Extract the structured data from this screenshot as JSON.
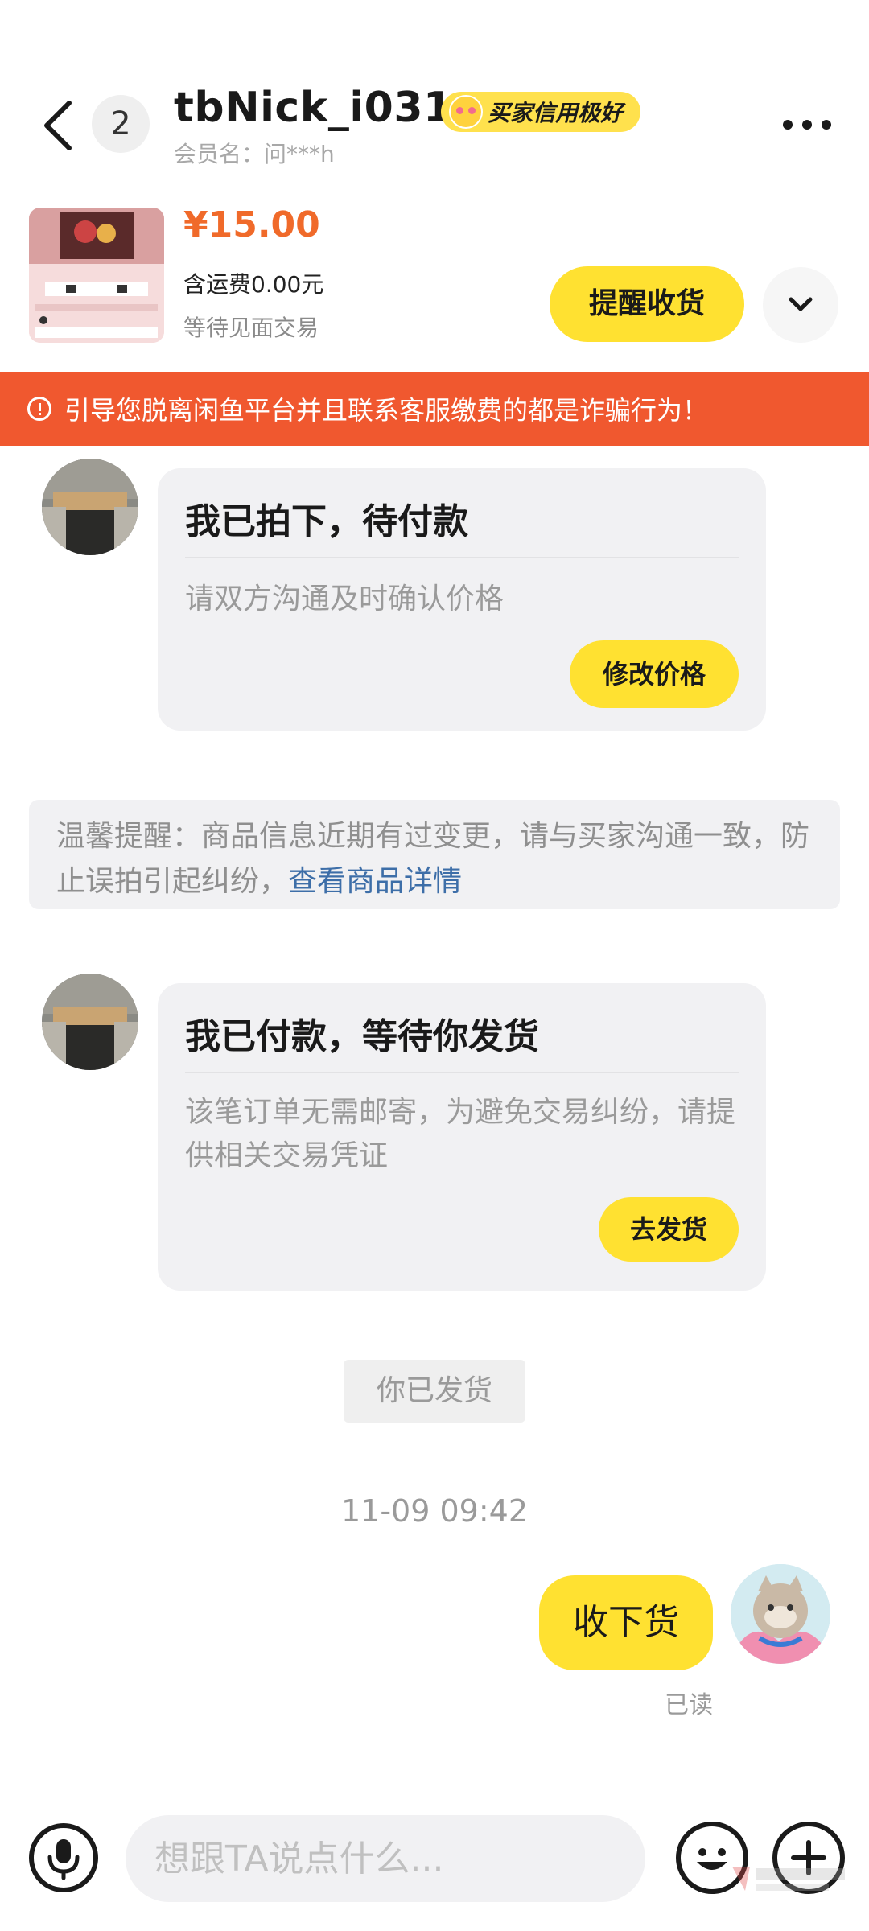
{
  "header": {
    "unread_count": "2",
    "nickname": "tbNick_i031r",
    "credit_badge": "买家信用极好",
    "member_name": "会员名：问***h"
  },
  "product": {
    "price": "¥15.00",
    "shipping": "含运费0.00元",
    "status": "等待见面交易",
    "remind_button": "提醒收货"
  },
  "warning_banner": "引导您脱离闲鱼平台并且联系客服缴费的都是诈骗行为！",
  "messages": {
    "card1": {
      "title": "我已拍下，待付款",
      "body": "请双方沟通及时确认价格",
      "button": "修改价格"
    },
    "notice": {
      "text": "温馨提醒：商品信息近期有过变更，请与买家沟通一致，防止误拍引起纠纷，",
      "link": "查看商品详情"
    },
    "card2": {
      "title": "我已付款，等待你发货",
      "body": "该笔订单无需邮寄，为避免交易纠纷，请提供相关交易凭证",
      "button": "去发货"
    },
    "system_shipped": "你已发货",
    "timestamp": "11-09 09:42",
    "my_message": "收下货",
    "read_receipt": "已读"
  },
  "input_bar": {
    "placeholder": "想跟TA说点什么..."
  },
  "colors": {
    "accent_yellow": "#ffe131",
    "warning_orange": "#f0582f",
    "price_orange": "#f06a2a",
    "link_blue": "#3d6ea8"
  },
  "icons": [
    "back-icon",
    "more-icon",
    "chevron-down-icon",
    "alert-icon",
    "microphone-icon",
    "emoji-icon",
    "plus-icon"
  ]
}
